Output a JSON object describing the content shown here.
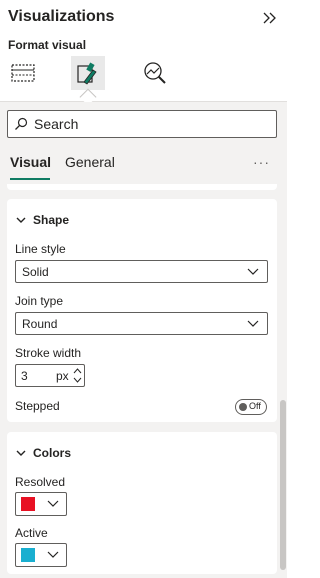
{
  "pane": {
    "title": "Visualizations",
    "subtitle": "Format visual",
    "icons": [
      "build-visual-icon",
      "format-visual-icon",
      "analytics-icon"
    ]
  },
  "search": {
    "placeholder": "Search"
  },
  "tabs": [
    {
      "label": "Visual",
      "active": true
    },
    {
      "label": "General",
      "active": false
    }
  ],
  "more_label": "···",
  "shape": {
    "title": "Shape",
    "line_style": {
      "label": "Line style",
      "value": "Solid"
    },
    "join_type": {
      "label": "Join type",
      "value": "Round"
    },
    "stroke_width": {
      "label": "Stroke width",
      "value": "3",
      "unit": "px"
    },
    "stepped": {
      "label": "Stepped",
      "state": "Off"
    }
  },
  "colors": {
    "title": "Colors",
    "resolved": {
      "label": "Resolved",
      "color": "#e81123"
    },
    "active": {
      "label": "Active",
      "color": "#1aafd0"
    }
  },
  "accent": "#0f7c63"
}
